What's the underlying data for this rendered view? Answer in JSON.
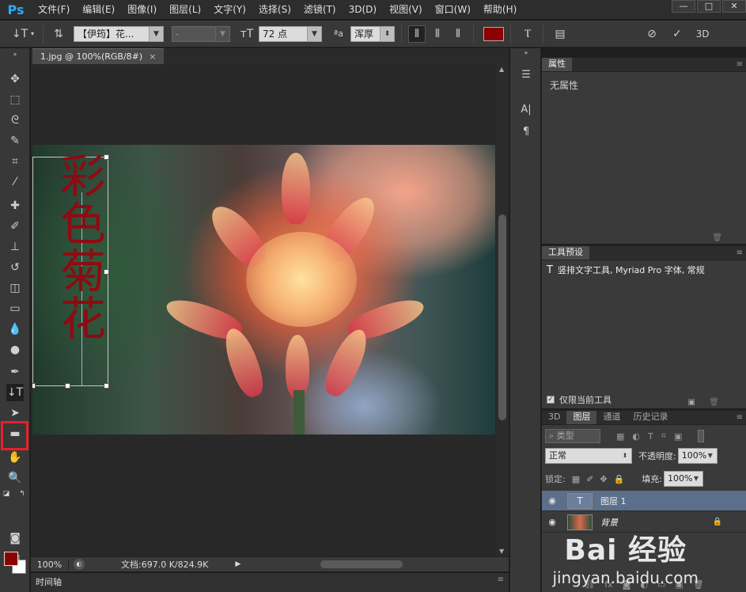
{
  "app": {
    "logo": "Ps"
  },
  "menu": [
    "文件(F)",
    "编辑(E)",
    "图像(I)",
    "图层(L)",
    "文字(Y)",
    "选择(S)",
    "滤镜(T)",
    "3D(D)",
    "视图(V)",
    "窗口(W)",
    "帮助(H)"
  ],
  "window_controls": {
    "minimize": "—",
    "maximize": "□",
    "close": "✕"
  },
  "options": {
    "font_family": "【伊筠】花...",
    "font_style": "-",
    "font_size": "72 点",
    "aa_label": "ªa",
    "antialias": "浑厚",
    "text_color": "#8b0000",
    "three_d": "3D"
  },
  "document": {
    "tab_title": "1.jpg @ 100%(RGB/8#)",
    "tab_close": "×"
  },
  "canvas_text": [
    "彩",
    "色",
    "菊",
    "花"
  ],
  "status": {
    "zoom": "100%",
    "doc": "文档:697.0 K/824.9K"
  },
  "timeline": {
    "label": "时间轴"
  },
  "properties_panel": {
    "tab": "属性",
    "content": "无属性"
  },
  "tool_presets_panel": {
    "tab": "工具预设",
    "preset_icon": "T",
    "preset_text": "竖排文字工具, Myriad Pro 字体, 常规",
    "current_only_label": "仅限当前工具"
  },
  "layers_panel": {
    "tabs": [
      "3D",
      "图层",
      "通道",
      "历史记录"
    ],
    "active_tab": "图层",
    "filter_label": "类型",
    "blend_mode": "正常",
    "opacity_label": "不透明度:",
    "opacity_value": "100%",
    "lock_label": "锁定:",
    "fill_label": "填充:",
    "fill_value": "100%",
    "layers": [
      {
        "name": "图层 1",
        "thumb": "T",
        "selected": true
      },
      {
        "name": "背景",
        "thumb": "",
        "selected": false,
        "locked": true
      }
    ]
  },
  "watermark": {
    "logo": "Bai  经验",
    "url": "jingyan.baidu.com"
  },
  "colors": {
    "foreground": "#8b0000",
    "background": "#ffffff",
    "accent": "#31a8ff",
    "highlight": "#e8202a"
  }
}
